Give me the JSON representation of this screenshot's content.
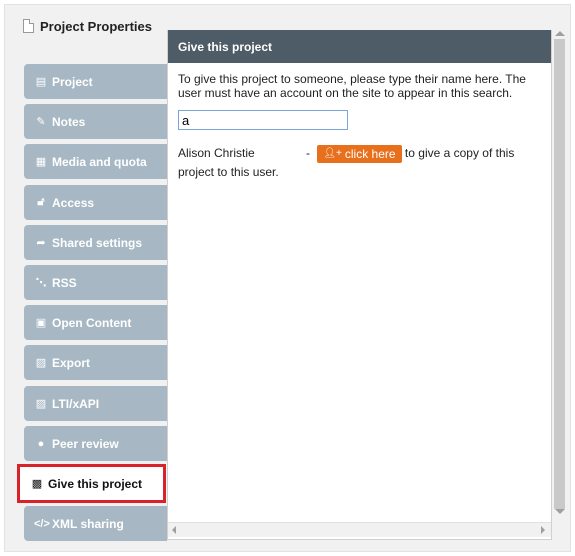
{
  "window": {
    "title": "Project Properties"
  },
  "sidebar": {
    "items": [
      {
        "label": "Project",
        "icon": "file-icon",
        "glyph": "▤"
      },
      {
        "label": "Notes",
        "icon": "edit-icon",
        "glyph": "✎"
      },
      {
        "label": "Media and quota",
        "icon": "film-icon",
        "glyph": "▦"
      },
      {
        "label": "Access",
        "icon": "unlock-icon",
        "glyph": "🔓︎"
      },
      {
        "label": "Shared settings",
        "icon": "share-icon",
        "glyph": "➦"
      },
      {
        "label": "RSS",
        "icon": "rss-icon",
        "glyph": "⋱"
      },
      {
        "label": "Open Content",
        "icon": "cc-icon",
        "glyph": "▣"
      },
      {
        "label": "Export",
        "icon": "save-icon",
        "glyph": "▨"
      },
      {
        "label": "LTI/xAPI",
        "icon": "save-icon",
        "glyph": "▨"
      },
      {
        "label": "Peer review",
        "icon": "comments-icon",
        "glyph": "●"
      },
      {
        "label": "Give this project",
        "icon": "gift-icon",
        "glyph": "▩",
        "active": true
      },
      {
        "label": "XML sharing",
        "icon": "code-icon",
        "glyph": "</>"
      }
    ]
  },
  "panel": {
    "header": "Give this project",
    "instructions": "To give this project to someone, please type their name here. The user must have an account on the site to appear in this search.",
    "search_value": "a",
    "result": {
      "name": "Alison Christie",
      "dash": "-",
      "button_label": "click here",
      "button_icon": "user-plus-icon",
      "suffix": "to give a copy of this project to this user."
    }
  },
  "colors": {
    "tab_bg": "#a7b8c4",
    "header_bg": "#4d5c66",
    "button_bg": "#e8701d",
    "highlight": "#d8232a"
  }
}
